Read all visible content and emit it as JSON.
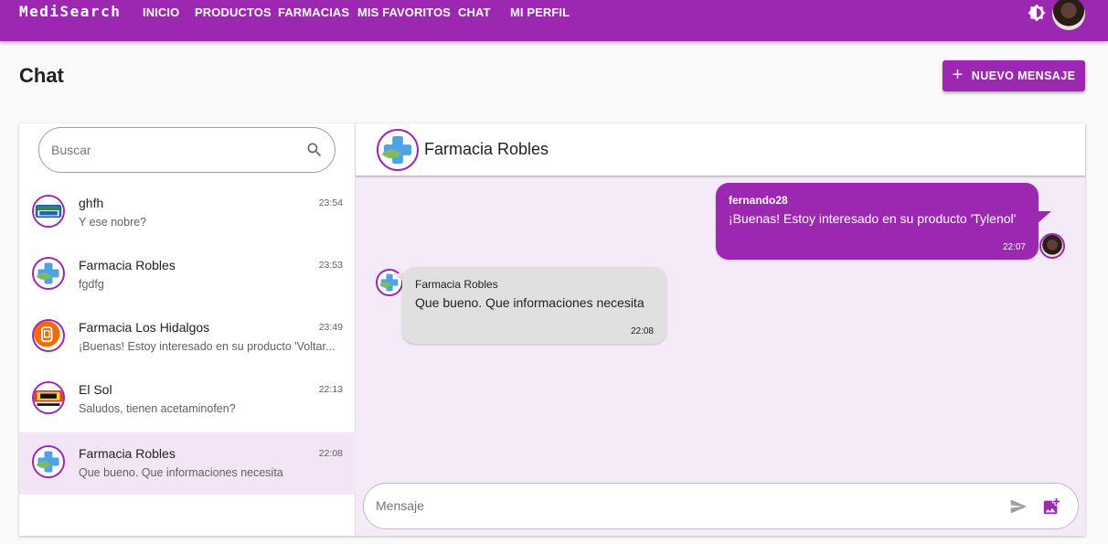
{
  "app": {
    "logo": "MediSearch"
  },
  "nav": {
    "items": [
      "INICIO",
      "PRODUCTOS",
      "FARMACIAS",
      "MIS FAVORITOS",
      "CHAT",
      "MI PERFIL"
    ]
  },
  "page": {
    "title": "Chat",
    "new_message_label": "NUEVO MENSAJE"
  },
  "search": {
    "placeholder": "Buscar"
  },
  "conversations": [
    {
      "name": "ghfh",
      "time": "23:54",
      "preview": "Y ese nobre?",
      "avatar": "lopez-logo"
    },
    {
      "name": "Farmacia Robles",
      "time": "23:53",
      "preview": "fgdfg",
      "avatar": "robles-cross-logo"
    },
    {
      "name": "Farmacia Los Hidalgos",
      "time": "23:49",
      "preview": "¡Buenas! Estoy interesado en su producto 'Voltar...",
      "avatar": "hidalgos-logo"
    },
    {
      "name": "El Sol",
      "time": "22:13",
      "preview": "Saludos, tienen acetaminofen?",
      "avatar": "el-sol-logo"
    },
    {
      "name": "Farmacia Robles",
      "time": "22:08",
      "preview": "Que bueno. Que informaciones necesita",
      "avatar": "robles-cross-logo",
      "active": true
    }
  ],
  "chat": {
    "contact_name": "Farmacia Robles",
    "messages": [
      {
        "direction": "out",
        "sender": "fernando28",
        "text": "¡Buenas! Estoy interesado en su producto 'Tylenol'",
        "time": "22:07"
      },
      {
        "direction": "in",
        "sender": "Farmacia Robles",
        "text": "Que bueno. Que informaciones necesita",
        "time": "22:08"
      }
    ],
    "composer_placeholder": "Mensaje"
  },
  "colors": {
    "primary": "#9c27b0",
    "chat_bg": "#f5eaf8",
    "active_item": "#f3e5f5"
  },
  "icons": [
    "theme-toggle-icon",
    "search-icon",
    "plus-icon",
    "send-icon",
    "add-image-icon"
  ]
}
